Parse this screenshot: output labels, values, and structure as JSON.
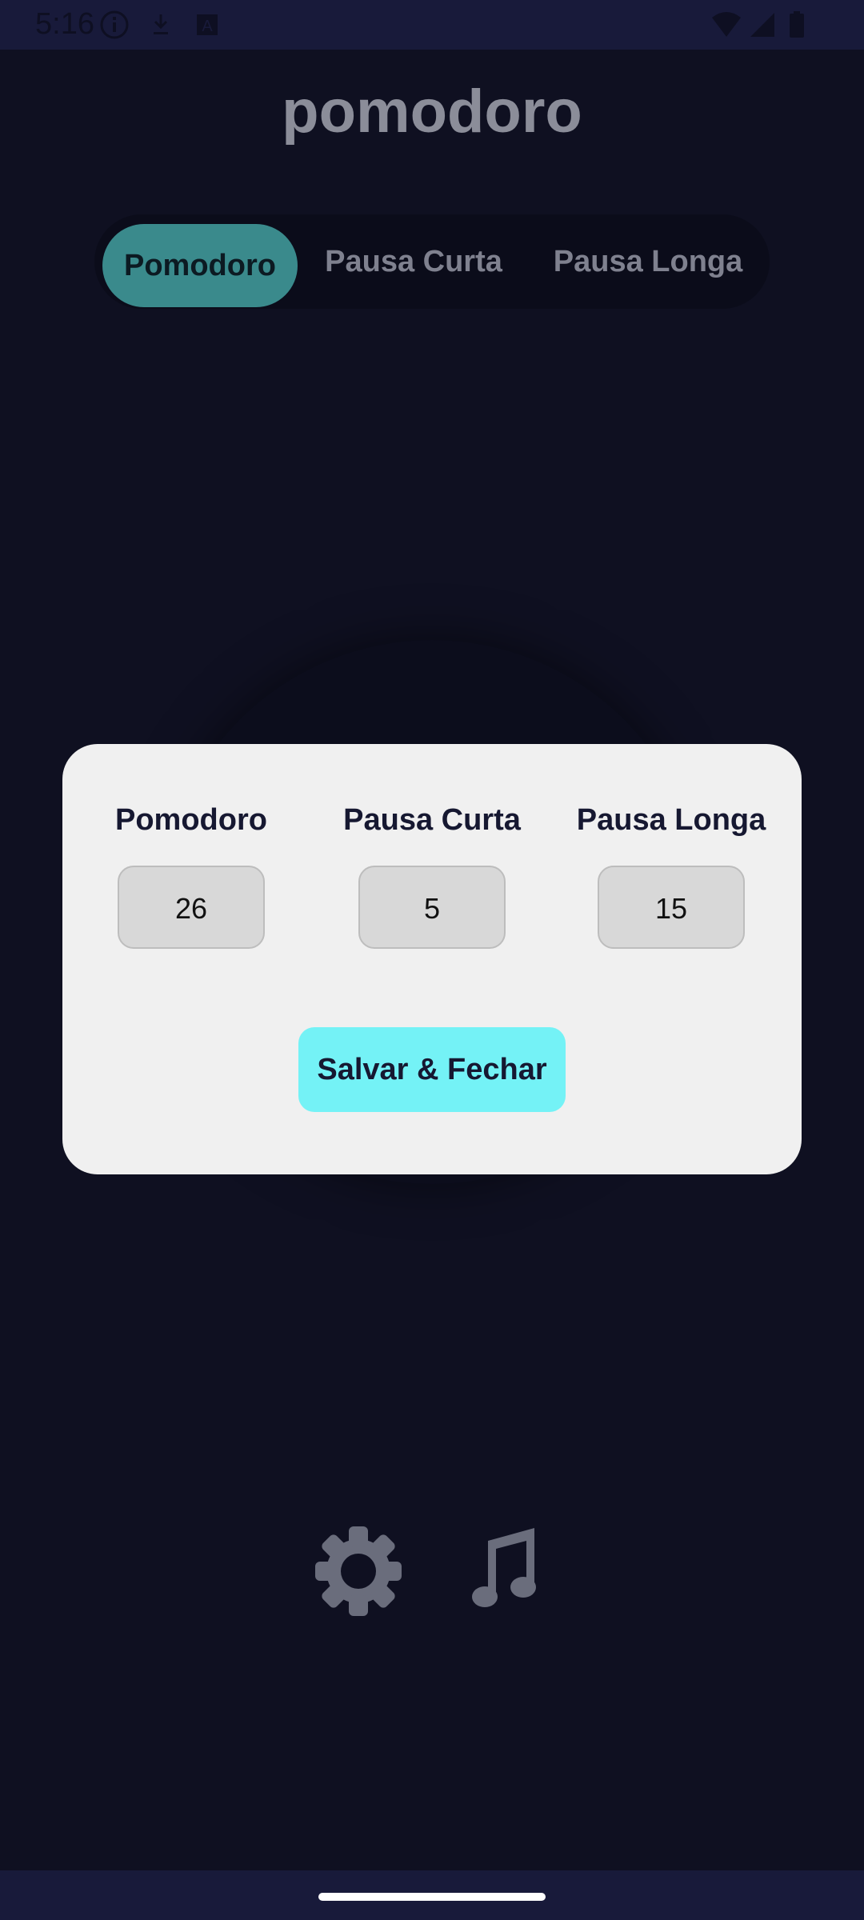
{
  "status_bar": {
    "time": "5:16",
    "icons_left": [
      "info-icon",
      "download-icon",
      "keyboard-a-icon"
    ],
    "icons_right": [
      "wifi-icon",
      "signal-icon",
      "battery-icon"
    ]
  },
  "app": {
    "title": "pomodoro",
    "tabs": [
      {
        "label": "Pomodoro",
        "active": true
      },
      {
        "label": "Pausa Curta",
        "active": false
      },
      {
        "label": "Pausa Longa",
        "active": false
      }
    ],
    "bottom_icons": [
      "gear-icon",
      "music-note-icon"
    ]
  },
  "modal": {
    "settings": [
      {
        "label": "Pomodoro",
        "value": "26"
      },
      {
        "label": "Pausa Curta",
        "value": "5"
      },
      {
        "label": "Pausa Longa",
        "value": "15"
      }
    ],
    "save_label": "Salvar & Fechar"
  },
  "colors": {
    "background": "#0f1021",
    "accent_active_tab": "#3a8a8c",
    "save_button": "#74f2f6",
    "modal_bg": "#f0f0f0"
  }
}
